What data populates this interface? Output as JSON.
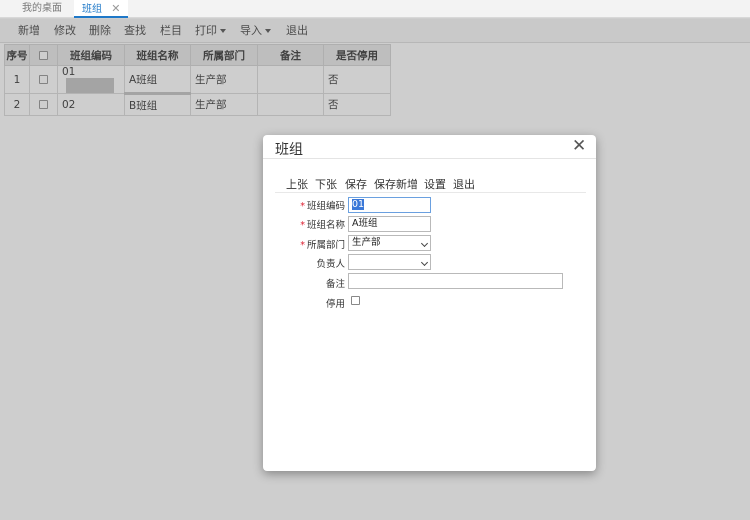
{
  "tabs": [
    {
      "label": "我的桌面",
      "active": false
    },
    {
      "label": "班组",
      "active": true,
      "close": "✕"
    }
  ],
  "toolbar": {
    "new": "新增",
    "edit": "修改",
    "delete": "删除",
    "find": "查找",
    "columns": "栏目",
    "print": "打印",
    "import": "导入",
    "exit": "退出"
  },
  "table": {
    "headers": [
      "序号",
      "",
      "班组编码",
      "班组名称",
      "所属部门",
      "备注",
      "是否停用"
    ],
    "rows": [
      {
        "index": "1",
        "code": "01",
        "name": "A班组",
        "dept": "生产部",
        "remark": "",
        "disabled": "否"
      },
      {
        "index": "2",
        "code": "02",
        "name": "B班组",
        "dept": "生产部",
        "remark": "",
        "disabled": "否"
      }
    ]
  },
  "dialog": {
    "title": "班组",
    "close": "✕",
    "toolbar": {
      "prev": "上张",
      "next": "下张",
      "save": "保存",
      "save_new": "保存新增",
      "settings": "设置",
      "exit": "退出"
    },
    "fields": {
      "code_label": "班组编码",
      "code_value": "01",
      "name_label": "班组名称",
      "name_value": "A班组",
      "dept_label": "所属部门",
      "dept_value": "生产部",
      "owner_label": "负责人",
      "owner_value": "",
      "remark_label": "备注",
      "remark_value": "",
      "disabled_label": "停用",
      "required_mark": "*"
    }
  },
  "colors": {
    "accent": "#1e78c8",
    "required": "#dd2233",
    "overlay": "rgba(120,120,120,0.36)"
  }
}
